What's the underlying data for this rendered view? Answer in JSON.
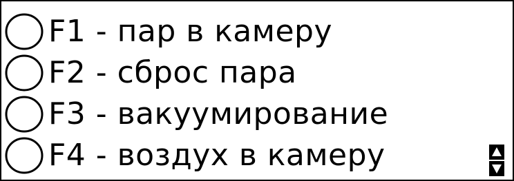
{
  "functions": [
    {
      "key": "F1",
      "label": "F1 - пар в камеру",
      "selected": false
    },
    {
      "key": "F2",
      "label": "F2 - сброс пара",
      "selected": false
    },
    {
      "key": "F3",
      "label": "F3 - вакуумирование",
      "selected": false
    },
    {
      "key": "F4",
      "label": "F4 - воздух в камеру",
      "selected": false
    }
  ],
  "navigation": {
    "up_icon": "triangle-up-icon",
    "down_icon": "triangle-down-icon"
  },
  "colors": {
    "foreground": "#000000",
    "background": "#ffffff"
  }
}
